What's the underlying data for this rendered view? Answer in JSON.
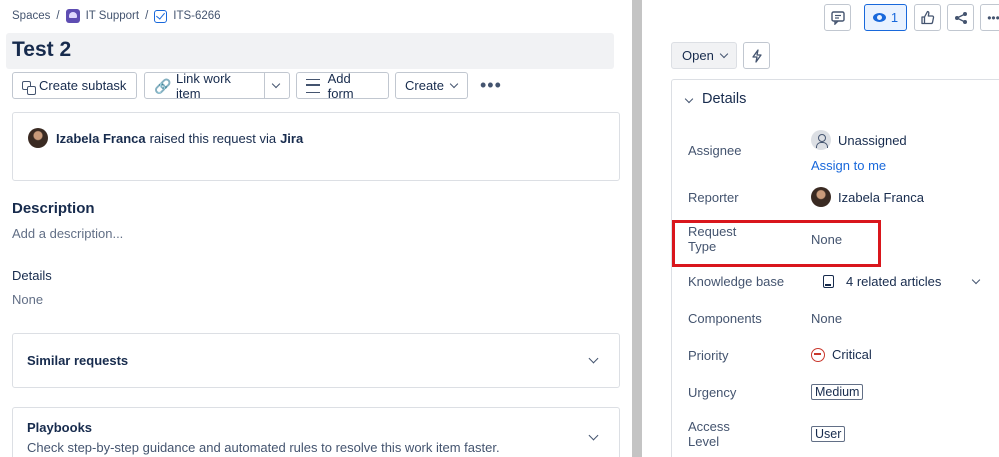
{
  "breadcrumb": {
    "spaces": "Spaces",
    "space": "IT Support",
    "issue_key": "ITS-6266",
    "separator": "/"
  },
  "issue": {
    "title": "Test 2"
  },
  "toolbar": {
    "create_subtask": "Create subtask",
    "link_work_item": "Link work item",
    "add_form": "Add form",
    "create": "Create",
    "more": "•••"
  },
  "request": {
    "reporter_name": "Izabela Franca",
    "middle_text": "raised this request via",
    "channel": "Jira"
  },
  "description": {
    "heading": "Description",
    "placeholder": "Add a description..."
  },
  "details_section": {
    "heading": "Details",
    "value": "None"
  },
  "similar_requests": {
    "title": "Similar requests"
  },
  "playbooks": {
    "title": "Playbooks",
    "subtitle": "Check step-by-step guidance and automated rules to resolve this work item faster."
  },
  "header_actions": {
    "watch_count": "1",
    "icons": [
      "feedback-icon",
      "eye-icon",
      "thumbs-up-icon",
      "share-icon",
      "more-icon"
    ]
  },
  "status": {
    "label": "Open"
  },
  "details_panel": {
    "title": "Details",
    "assignee_label": "Assignee",
    "assignee_value": "Unassigned",
    "assign_to_me": "Assign to me",
    "reporter_label": "Reporter",
    "reporter_value": "Izabela Franca",
    "request_type_label_1": "Request",
    "request_type_label_2": "Type",
    "request_type_value": "None",
    "knowledge_base_label": "Knowledge base",
    "knowledge_base_value": "4 related articles",
    "components_label": "Components",
    "components_value": "None",
    "priority_label": "Priority",
    "priority_value": "Critical",
    "urgency_label": "Urgency",
    "urgency_value": "Medium",
    "access_label_1": "Access",
    "access_label_2": "Level",
    "access_value": "User"
  },
  "colors": {
    "accent": "#1868db",
    "critical": "#c9372c",
    "highlight_box": "#d9161c"
  }
}
